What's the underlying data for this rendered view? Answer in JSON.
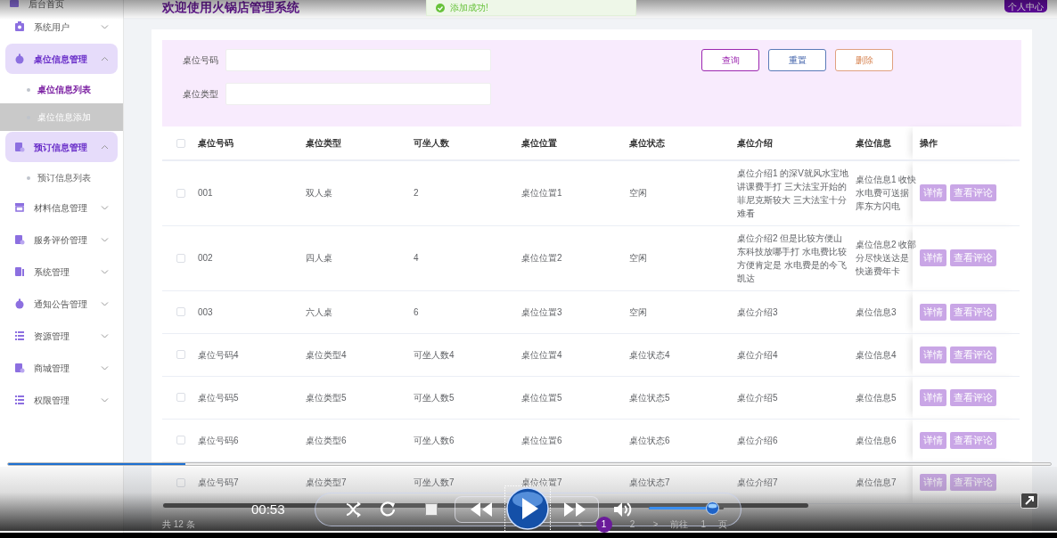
{
  "header": {
    "title": "欢迎使用火锅店管理系统",
    "profile_button": "个人中心"
  },
  "toast": {
    "message": "添加成功!"
  },
  "sidebar": {
    "items": [
      {
        "kind": "link",
        "label": "后台首页"
      },
      {
        "kind": "group",
        "label": "系统用户",
        "expanded": false
      },
      {
        "kind": "group",
        "label": "桌位信息管理",
        "expanded": true,
        "children": [
          {
            "label": "桌位信息列表",
            "selected": true,
            "hovered": false
          },
          {
            "label": "桌位信息添加",
            "selected": false,
            "hovered": true
          }
        ]
      },
      {
        "kind": "group",
        "label": "预订信息管理",
        "expanded": true,
        "children": [
          {
            "label": "预订信息列表",
            "selected": false,
            "hovered": false
          }
        ]
      },
      {
        "kind": "group",
        "label": "材料信息管理",
        "expanded": false
      },
      {
        "kind": "group",
        "label": "服务评价管理",
        "expanded": false
      },
      {
        "kind": "group",
        "label": "系统管理",
        "expanded": false
      },
      {
        "kind": "group",
        "label": "通知公告管理",
        "expanded": false
      },
      {
        "kind": "group",
        "label": "资源管理",
        "expanded": false
      },
      {
        "kind": "group",
        "label": "商城管理",
        "expanded": false
      },
      {
        "kind": "group",
        "label": "权限管理",
        "expanded": false
      }
    ]
  },
  "search": {
    "fields": [
      {
        "label": "桌位号码"
      },
      {
        "label": "桌位类型"
      }
    ],
    "buttons": [
      {
        "label": "查询",
        "kind": "query"
      },
      {
        "label": "重置",
        "kind": "reset"
      },
      {
        "label": "删除",
        "kind": "delete"
      }
    ]
  },
  "table": {
    "header_checked": false,
    "columns": [
      "桌位号码",
      "桌位类型",
      "可坐人数",
      "桌位位置",
      "桌位状态",
      "桌位介绍",
      "桌位信息",
      "操作"
    ],
    "rows": [
      {
        "checked": false,
        "cells": [
          "001",
          "双人桌",
          "2",
          "桌位位置1",
          "空闲",
          "桌位介绍1 的深V就风水宝地讲课费手打 三大法宝开始的菲尼克斯较大 三大法宝十分难看",
          "桌位信息1 收快水电费可送据库东方闪电"
        ],
        "actions": [
          "详情",
          "查看评论"
        ]
      },
      {
        "checked": false,
        "cells": [
          "002",
          "四人桌",
          "4",
          "桌位位置2",
          "空闲",
          "桌位介绍2 但是比较方便山东科技放哪手打 水电费比较方便肯定是 水电费是的今飞凯达",
          "桌位信息2 收部分尽快送达是快递费年卡"
        ],
        "actions": [
          "详情",
          "查看评论"
        ]
      },
      {
        "checked": false,
        "cells": [
          "003",
          "六人桌",
          "6",
          "桌位位置3",
          "空闲",
          "桌位介绍3",
          "桌位信息3"
        ],
        "actions": [
          "详情",
          "查看评论"
        ]
      },
      {
        "checked": false,
        "cells": [
          "桌位号码4",
          "桌位类型4",
          "可坐人数4",
          "桌位位置4",
          "桌位状态4",
          "桌位介绍4",
          "桌位信息4"
        ],
        "actions": [
          "详情",
          "查看评论"
        ]
      },
      {
        "checked": false,
        "cells": [
          "桌位号码5",
          "桌位类型5",
          "可坐人数5",
          "桌位位置5",
          "桌位状态5",
          "桌位介绍5",
          "桌位信息5"
        ],
        "actions": [
          "详情",
          "查看评论"
        ]
      },
      {
        "checked": false,
        "cells": [
          "桌位号码6",
          "桌位类型6",
          "可坐人数6",
          "桌位位置6",
          "桌位状态6",
          "桌位介绍6",
          "桌位信息6"
        ],
        "actions": [
          "详情",
          "查看评论"
        ]
      },
      {
        "checked": false,
        "cells": [
          "桌位号码7",
          "桌位类型7",
          "可坐人数7",
          "桌位位置7",
          "桌位状态7",
          "桌位介绍7",
          "桌位信息7"
        ],
        "actions": [
          "详情",
          "查看评论"
        ]
      }
    ]
  },
  "pagination": {
    "total": "共 12 条",
    "prev": "<",
    "pages": [
      {
        "label": "1",
        "selected": true
      },
      {
        "label": "2",
        "selected": false
      }
    ],
    "next": ">",
    "goto_label": "前往",
    "goto_value": "1",
    "page_unit": "页"
  },
  "player": {
    "time": "00:53",
    "playing": false,
    "progress": {
      "level": 0.17
    },
    "volume": {
      "level": 0.85
    }
  }
}
